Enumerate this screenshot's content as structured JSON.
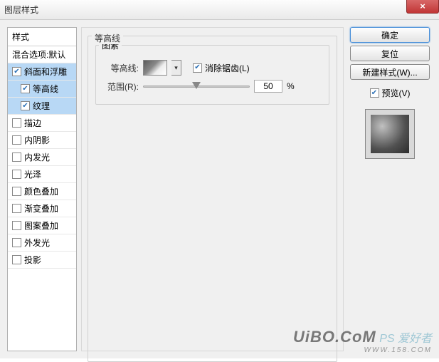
{
  "window": {
    "title": "图层样式"
  },
  "left": {
    "header": "样式",
    "blend": "混合选项:默认",
    "items": [
      {
        "label": "斜面和浮雕",
        "checked": true,
        "selected": true,
        "sub": false
      },
      {
        "label": "等高线",
        "checked": true,
        "selected": true,
        "sub": true
      },
      {
        "label": "纹理",
        "checked": true,
        "selected": true,
        "sub": true
      },
      {
        "label": "描边",
        "checked": false,
        "selected": false,
        "sub": false
      },
      {
        "label": "内阴影",
        "checked": false,
        "selected": false,
        "sub": false
      },
      {
        "label": "内发光",
        "checked": false,
        "selected": false,
        "sub": false
      },
      {
        "label": "光泽",
        "checked": false,
        "selected": false,
        "sub": false
      },
      {
        "label": "颜色叠加",
        "checked": false,
        "selected": false,
        "sub": false
      },
      {
        "label": "渐变叠加",
        "checked": false,
        "selected": false,
        "sub": false
      },
      {
        "label": "图案叠加",
        "checked": false,
        "selected": false,
        "sub": false
      },
      {
        "label": "外发光",
        "checked": false,
        "selected": false,
        "sub": false
      },
      {
        "label": "投影",
        "checked": false,
        "selected": false,
        "sub": false
      }
    ]
  },
  "center": {
    "group_title": "等高线",
    "subgroup_title": "图素",
    "contour_label": "等高线:",
    "antialias_label": "消除锯齿(L)",
    "antialias_checked": true,
    "range_label": "范围(R):",
    "range_value": "50",
    "range_unit": "%"
  },
  "right": {
    "ok": "确定",
    "cancel": "复位",
    "newstyle": "新建样式(W)...",
    "preview_label": "预览(V)",
    "preview_checked": true
  },
  "watermark": {
    "big": "UiBO.CoM",
    "tag": "PS 爱好者",
    "url": "WWW.158.COM"
  }
}
